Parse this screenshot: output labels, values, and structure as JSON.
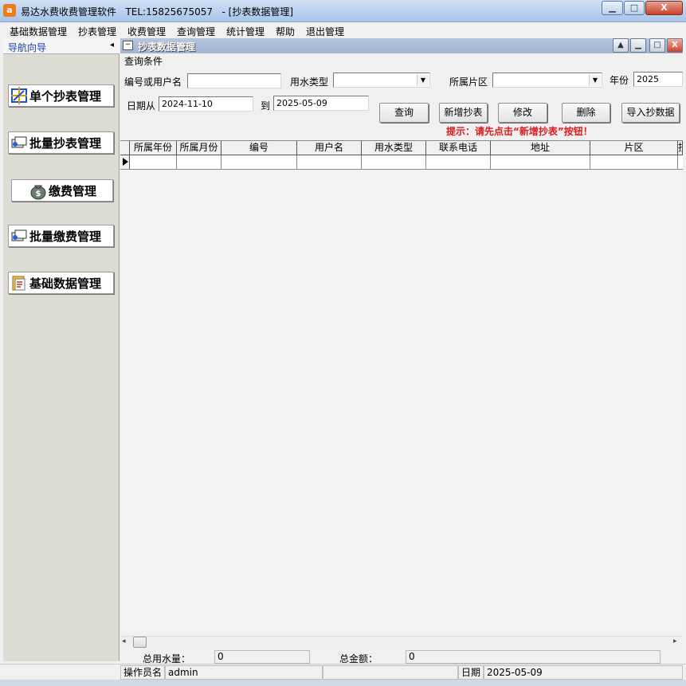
{
  "window": {
    "title": "易达水费收费管理软件   TEL:15825675057   - [抄表数据管理]",
    "min_glyph": "▁",
    "max_glyph": "□",
    "close_glyph": "X",
    "app_icon_glyph": "a"
  },
  "menu": [
    "基础数据管理",
    "抄表管理",
    "收费管理",
    "查询管理",
    "统计管理",
    "帮助",
    "退出管理"
  ],
  "nav": {
    "title": "导航向导",
    "collapse_glyph": "◂",
    "items": [
      {
        "label": "单个抄表管理",
        "icon": "meter-icon"
      },
      {
        "label": "批量抄表管理",
        "icon": "batch-meter-icon"
      },
      {
        "label": "缴费管理",
        "icon": "money-bag-icon"
      },
      {
        "label": "批量缴费管理",
        "icon": "batch-payment-icon"
      },
      {
        "label": "基础数据管理",
        "icon": "data-folder-icon"
      }
    ]
  },
  "child": {
    "title": "抄表数据管理",
    "sys_glyph": "−"
  },
  "query": {
    "group_label": "查询条件",
    "id_label": "编号或用户名",
    "id_value": "",
    "type_label": "用水类型",
    "type_value": "",
    "area_label": "所属片区",
    "area_value": "",
    "year_label": "年份",
    "year_value": "2025",
    "date_from_label": "日期从",
    "date_from": "2024-11-10",
    "date_to_label": "到",
    "date_to": "2025-05-09",
    "buttons": {
      "search": "查询",
      "add": "新增抄表",
      "edit": "修改",
      "delete": "删除",
      "import": "导入抄数据"
    },
    "hint": "提示：请先点击“新增抄表”按钮！"
  },
  "grid": {
    "columns": [
      "所属年份",
      "所属月份",
      "编号",
      "用户名",
      "用水类型",
      "联系电话",
      "地址",
      "片区",
      "抄"
    ]
  },
  "totals": {
    "water_label": "总用水量：",
    "water_value": "0",
    "amount_label": "总金额：",
    "amount_value": "0"
  },
  "status": {
    "operator_label": "操作员名",
    "operator_value": "admin",
    "date_label": "日期",
    "date_value": "2025-05-09"
  },
  "scroll": {
    "left_glyph": "◂",
    "right_glyph": "▸"
  }
}
